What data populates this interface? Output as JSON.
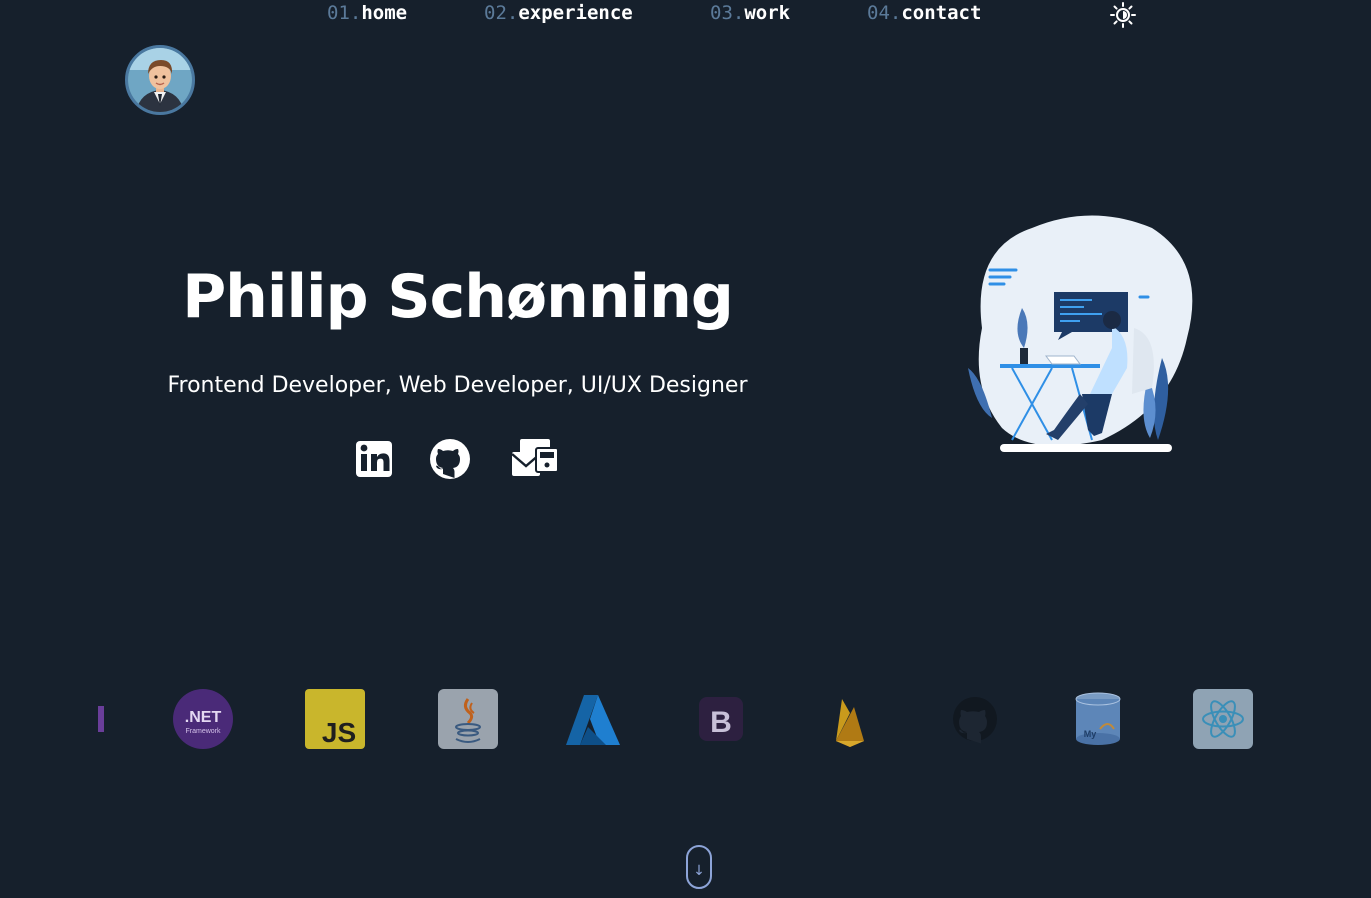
{
  "nav": {
    "items": [
      {
        "num": "01.",
        "label": "home"
      },
      {
        "num": "02.",
        "label": "experience"
      },
      {
        "num": "03.",
        "label": "work"
      },
      {
        "num": "04.",
        "label": "contact"
      }
    ],
    "theme_toggle_icon": "sun-icon"
  },
  "hero": {
    "name": "Philip Schønning",
    "subtitle": "Frontend Developer, Web Developer, UI/UX Designer",
    "socials": [
      {
        "icon": "linkedin-icon"
      },
      {
        "icon": "github-icon"
      },
      {
        "icon": "mail-icon"
      }
    ]
  },
  "tech_stack": [
    {
      "icon": "dotnet-icon",
      "text": ".NET",
      "subtext": "Framework"
    },
    {
      "icon": "javascript-icon",
      "text": "JS"
    },
    {
      "icon": "java-icon"
    },
    {
      "icon": "azure-icon"
    },
    {
      "icon": "bootstrap-icon",
      "text": "B"
    },
    {
      "icon": "firebase-icon"
    },
    {
      "icon": "github-icon"
    },
    {
      "icon": "mysql-icon",
      "text": "My"
    },
    {
      "icon": "react-icon"
    }
  ],
  "colors": {
    "background": "#16202c",
    "accent": "#5b7a99",
    "scroll_border": "#8da4d8"
  },
  "scroll": {
    "icon": "arrow-down-icon",
    "glyph": "↓"
  }
}
